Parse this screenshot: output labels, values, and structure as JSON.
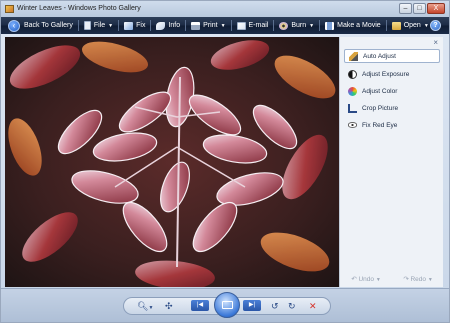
{
  "window": {
    "title": "Winter Leaves - Windows Photo Gallery"
  },
  "window_controls": {
    "minimize": "–",
    "maximize": "□",
    "close": "X"
  },
  "command_bar": {
    "back_label": "Back To Gallery",
    "file_label": "File",
    "fix_label": "Fix",
    "info_label": "Info",
    "print_label": "Print",
    "email_label": "E-mail",
    "burn_label": "Burn",
    "make_movie_label": "Make a Movie",
    "open_label": "Open",
    "help_label": "?"
  },
  "fix_panel": {
    "close_label": "×",
    "items": [
      {
        "label": "Auto Adjust",
        "icon": "wand-icon",
        "selected": true
      },
      {
        "label": "Adjust Exposure",
        "icon": "exposure-icon",
        "selected": false
      },
      {
        "label": "Adjust Color",
        "icon": "color-icon",
        "selected": false
      },
      {
        "label": "Crop Picture",
        "icon": "crop-icon",
        "selected": false
      },
      {
        "label": "Fix Red Eye",
        "icon": "eye-icon",
        "selected": false
      }
    ],
    "undo_label": "Undo",
    "redo_label": "Redo"
  },
  "bottom_toolbar": {
    "zoom_icon": "magnifier-icon",
    "fit_icon": "actual-size-icon",
    "previous_icon": "previous-icon",
    "slideshow_icon": "slideshow-icon",
    "next_icon": "next-icon",
    "rotate_ccw_icon": "rotate-left-icon",
    "rotate_cw_icon": "rotate-right-icon",
    "delete_icon": "delete-icon"
  },
  "colors": {
    "command_bar": "#1b2a44",
    "photo_background": "#2a1d1d",
    "leaf_red": "#b23a3f",
    "frost": "#f4e6ee",
    "delete_red": "#d6332a"
  }
}
